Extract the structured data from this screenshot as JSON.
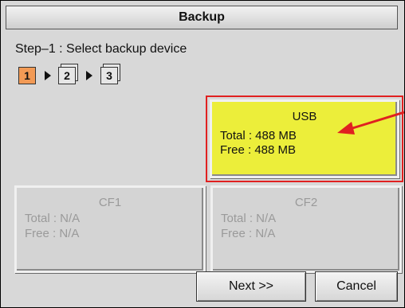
{
  "window": {
    "title": "Backup"
  },
  "wizard": {
    "step_label": "Step–1 : Select backup device",
    "steps": [
      "1",
      "2",
      "3"
    ],
    "active_step": 1
  },
  "devices": {
    "usb": {
      "name": "USB",
      "total": "Total : 488 MB",
      "free": "Free : 488 MB",
      "selected": true
    },
    "cf1": {
      "name": "CF1",
      "total": "Total : N/A",
      "free": "Free : N/A",
      "selected": false
    },
    "cf2": {
      "name": "CF2",
      "total": "Total : N/A",
      "free": "Free : N/A",
      "selected": false
    }
  },
  "buttons": {
    "next": "Next >>",
    "cancel": "Cancel"
  },
  "colors": {
    "active_step": "#f29a55",
    "selected_device": "#ecee3a",
    "highlight": "#e02020",
    "disabled_text": "#9a9a9a"
  }
}
